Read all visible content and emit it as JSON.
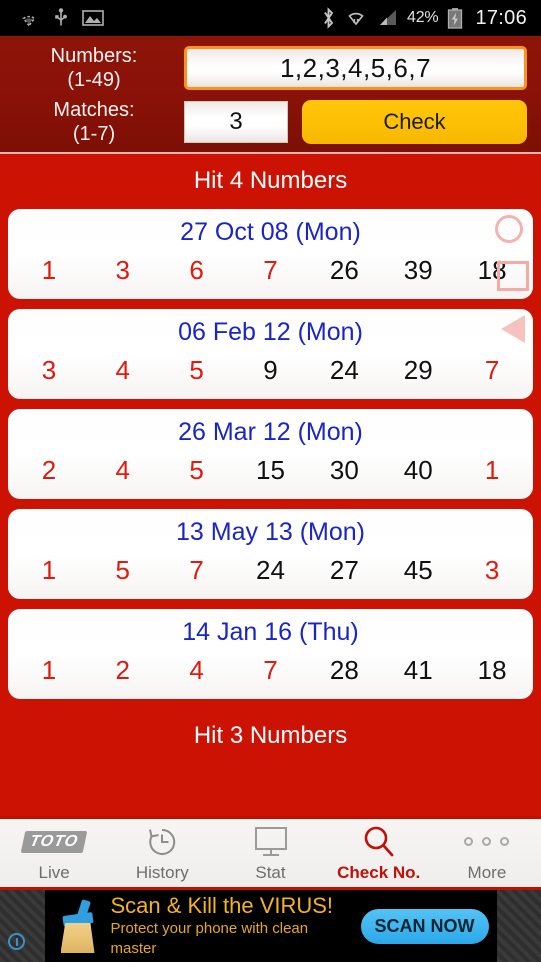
{
  "statusbar": {
    "left_icons": [
      "wifi-weak-icon",
      "usb-icon",
      "image-icon"
    ],
    "right_icons": [
      "bluetooth-icon",
      "wifi-icon",
      "signal-icon"
    ],
    "battery_percent": "42%",
    "battery_icon": "battery-charging-icon",
    "clock": "17:06"
  },
  "header": {
    "numbers_label": "Numbers:",
    "numbers_range": "(1-49)",
    "numbers_value": "1,2,3,4,5,6,7",
    "numbers_placeholder": "1,2,3,4,5,6,7",
    "matches_label": "Matches:",
    "matches_range": "(1-7)",
    "matches_value": "3",
    "matches_placeholder": "3",
    "check_label": "Check",
    "accent_orange": "#f7941e",
    "accent_yellow": "#fdc005",
    "header_bg": "#8a1208"
  },
  "results": {
    "group_title_1": "Hit 4 Numbers",
    "group_title_2": "Hit 3 Numbers",
    "hit_color": "#e01b0c",
    "miss_color": "#111111",
    "date_color": "#1a25c4",
    "cards": [
      {
        "date": "27 Oct 08 (Mon)",
        "numbers": [
          "1",
          "3",
          "6",
          "7",
          "26",
          "39",
          "18"
        ],
        "hits": [
          true,
          true,
          true,
          true,
          false,
          false,
          false
        ],
        "watermark": "circle-square-outline"
      },
      {
        "date": "06 Feb 12 (Mon)",
        "numbers": [
          "3",
          "4",
          "5",
          "9",
          "24",
          "29",
          "7"
        ],
        "hits": [
          true,
          true,
          true,
          false,
          false,
          false,
          true
        ],
        "watermark": "triangle-left-outline"
      },
      {
        "date": "26 Mar 12 (Mon)",
        "numbers": [
          "2",
          "4",
          "5",
          "15",
          "30",
          "40",
          "1"
        ],
        "hits": [
          true,
          true,
          true,
          false,
          false,
          false,
          true
        ],
        "watermark": "none"
      },
      {
        "date": "13 May 13 (Mon)",
        "numbers": [
          "1",
          "5",
          "7",
          "24",
          "27",
          "45",
          "3"
        ],
        "hits": [
          true,
          true,
          true,
          false,
          false,
          false,
          true
        ],
        "watermark": "none"
      },
      {
        "date": "14 Jan 16 (Thu)",
        "numbers": [
          "1",
          "2",
          "4",
          "7",
          "28",
          "41",
          "18"
        ],
        "hits": [
          true,
          true,
          true,
          true,
          false,
          false,
          false
        ],
        "watermark": "none"
      }
    ]
  },
  "navbar": {
    "active_color": "#c01008",
    "items": [
      {
        "label": "Live",
        "icon": "toto-logo-icon",
        "logo_text": "TOTO",
        "active": false
      },
      {
        "label": "History",
        "icon": "clock-rewind-icon",
        "active": false
      },
      {
        "label": "Stat",
        "icon": "monitor-icon",
        "active": false
      },
      {
        "label": "Check No.",
        "icon": "magnifier-icon",
        "active": true
      },
      {
        "label": "More",
        "icon": "three-dots-icon",
        "active": false
      }
    ]
  },
  "ad": {
    "title": "Scan & Kill the VIRUS!",
    "subtitle": "Protect your phone with clean master",
    "cta": "SCAN NOW",
    "icon": "broom-icon",
    "info_icon": "info-icon",
    "cta_color": "#2ba8ea",
    "title_color": "#f5b323"
  }
}
